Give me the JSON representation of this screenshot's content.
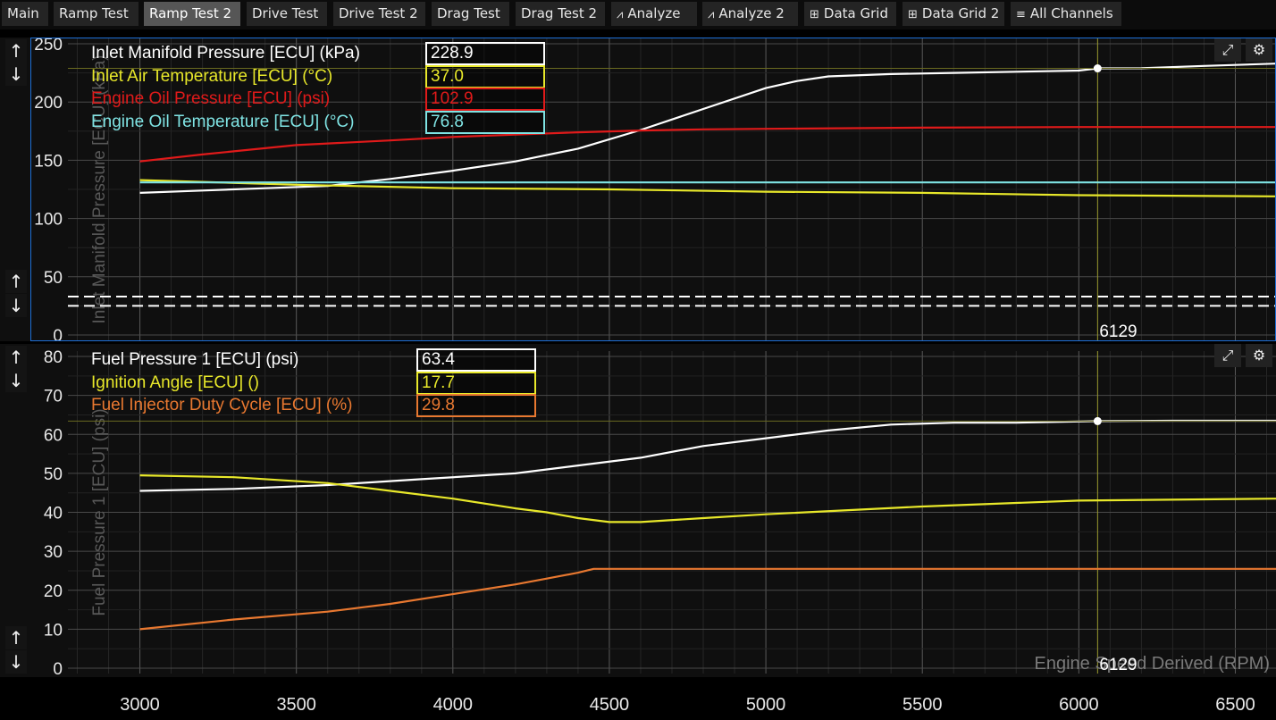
{
  "tabs": [
    {
      "label": "Main",
      "icon": "",
      "active": false
    },
    {
      "label": "Ramp Test",
      "icon": "",
      "active": false
    },
    {
      "label": "Ramp Test 2",
      "icon": "",
      "active": true
    },
    {
      "label": "Drive Test",
      "icon": "",
      "active": false
    },
    {
      "label": "Drive Test 2",
      "icon": "",
      "active": false
    },
    {
      "label": "Drag Test",
      "icon": "",
      "active": false
    },
    {
      "label": "Drag Test 2",
      "icon": "",
      "active": false
    },
    {
      "label": "Analyze",
      "icon": "analyze-icon",
      "active": false
    },
    {
      "label": "Analyze 2",
      "icon": "analyze-icon",
      "active": false
    },
    {
      "label": "Data Grid",
      "icon": "grid-icon",
      "active": false
    },
    {
      "label": "Data Grid 2",
      "icon": "grid-icon",
      "active": false
    },
    {
      "label": "All Channels",
      "icon": "list-icon",
      "active": false
    }
  ],
  "colors": {
    "white": "#ffffff",
    "yellow": "#e8e82a",
    "red": "#e01a1a",
    "cyan": "#7fe3e3",
    "orange": "#e87830",
    "selection_border": "#1e6fd6",
    "cursor": "#9a9a30"
  },
  "cursor": {
    "x": 6060,
    "label": "6129"
  },
  "chart_data": [
    {
      "type": "line",
      "title": "",
      "ylabel": "Inlet Manifold Pressure [ECU] (kPa)",
      "xlabel": "",
      "xlim": [
        2770,
        6630
      ],
      "ylim": [
        0,
        250
      ],
      "grid": true,
      "yticks": [
        0,
        50,
        100,
        150,
        200,
        250
      ],
      "dashed_lines": [
        25,
        33
      ],
      "series": [
        {
          "name": "Inlet Manifold Pressure [ECU] (kPa)",
          "color": "#ffffff",
          "value": "228.9",
          "x": [
            3000,
            3200,
            3400,
            3600,
            3800,
            4000,
            4200,
            4400,
            4600,
            4800,
            5000,
            5100,
            5200,
            5400,
            5600,
            5800,
            6000,
            6060,
            6200,
            6400,
            6630
          ],
          "y": [
            122,
            124,
            126,
            128,
            134,
            141,
            149,
            160,
            176,
            194,
            212,
            218,
            222,
            224,
            225,
            226,
            227,
            228.9,
            229,
            231,
            233
          ]
        },
        {
          "name": "Inlet Air Temperature [ECU] (°C)",
          "color": "#e8e82a",
          "value": "37.0",
          "x": [
            3000,
            3500,
            4000,
            4500,
            5000,
            5500,
            6000,
            6630
          ],
          "y": [
            133,
            129,
            126,
            125,
            123,
            122,
            120,
            119
          ]
        },
        {
          "name": "Engine Oil Pressure [ECU] (psi)",
          "color": "#e01a1a",
          "value": "102.9",
          "x": [
            3000,
            3200,
            3500,
            3800,
            4000,
            4200,
            4400,
            4600,
            4800,
            5000,
            5500,
            6000,
            6630
          ],
          "y": [
            149,
            155,
            163,
            167,
            170,
            172,
            174,
            175.5,
            176.5,
            177,
            178,
            178.5,
            178.5
          ]
        },
        {
          "name": "Engine Oil Temperature [ECU] (°C)",
          "color": "#7fe3e3",
          "value": "76.8",
          "x": [
            3000,
            3500,
            4000,
            5000,
            6000,
            6630
          ],
          "y": [
            131,
            131,
            131,
            131,
            131,
            131
          ]
        }
      ]
    },
    {
      "type": "line",
      "title": "",
      "ylabel": "Fuel Pressure 1 [ECU] (psi)",
      "xlabel": "Engine Speed Derived (RPM)",
      "xlim": [
        2770,
        6630
      ],
      "ylim": [
        0,
        80
      ],
      "grid": true,
      "yticks": [
        0,
        10,
        20,
        30,
        40,
        50,
        60,
        70,
        80
      ],
      "xticks": [
        3000,
        3500,
        4000,
        4500,
        5000,
        5500,
        6000,
        6500
      ],
      "series": [
        {
          "name": "Fuel Pressure 1 [ECU] (psi)",
          "color": "#ffffff",
          "value": "63.4",
          "x": [
            3000,
            3300,
            3600,
            3900,
            4200,
            4400,
            4600,
            4800,
            5000,
            5200,
            5400,
            5600,
            5800,
            6060,
            6300,
            6630
          ],
          "y": [
            45.5,
            46,
            47,
            48.5,
            50,
            52,
            54,
            57,
            59,
            61,
            62.5,
            63,
            63,
            63.4,
            63.5,
            63.5
          ]
        },
        {
          "name": "Ignition Angle [ECU] ()",
          "color": "#e8e82a",
          "value": "17.7",
          "x": [
            3000,
            3300,
            3600,
            3800,
            4000,
            4200,
            4300,
            4400,
            4500,
            4600,
            4800,
            5000,
            5500,
            6000,
            6630
          ],
          "y": [
            49.5,
            49,
            47.5,
            45.5,
            43.5,
            41,
            40,
            38.5,
            37.5,
            37.5,
            38.5,
            39.5,
            41.5,
            43,
            43.5
          ]
        },
        {
          "name": "Fuel Injector Duty Cycle  [ECU] (%)",
          "color": "#e87830",
          "value": "29.8",
          "x": [
            3000,
            3300,
            3600,
            3800,
            4000,
            4200,
            4300,
            4400,
            4450,
            4500,
            5000,
            5500,
            6000,
            6630
          ],
          "y": [
            10,
            12.5,
            14.5,
            16.5,
            19,
            21.5,
            23,
            24.5,
            25.5,
            25.5,
            25.5,
            25.5,
            25.5,
            25.5
          ]
        }
      ]
    }
  ]
}
